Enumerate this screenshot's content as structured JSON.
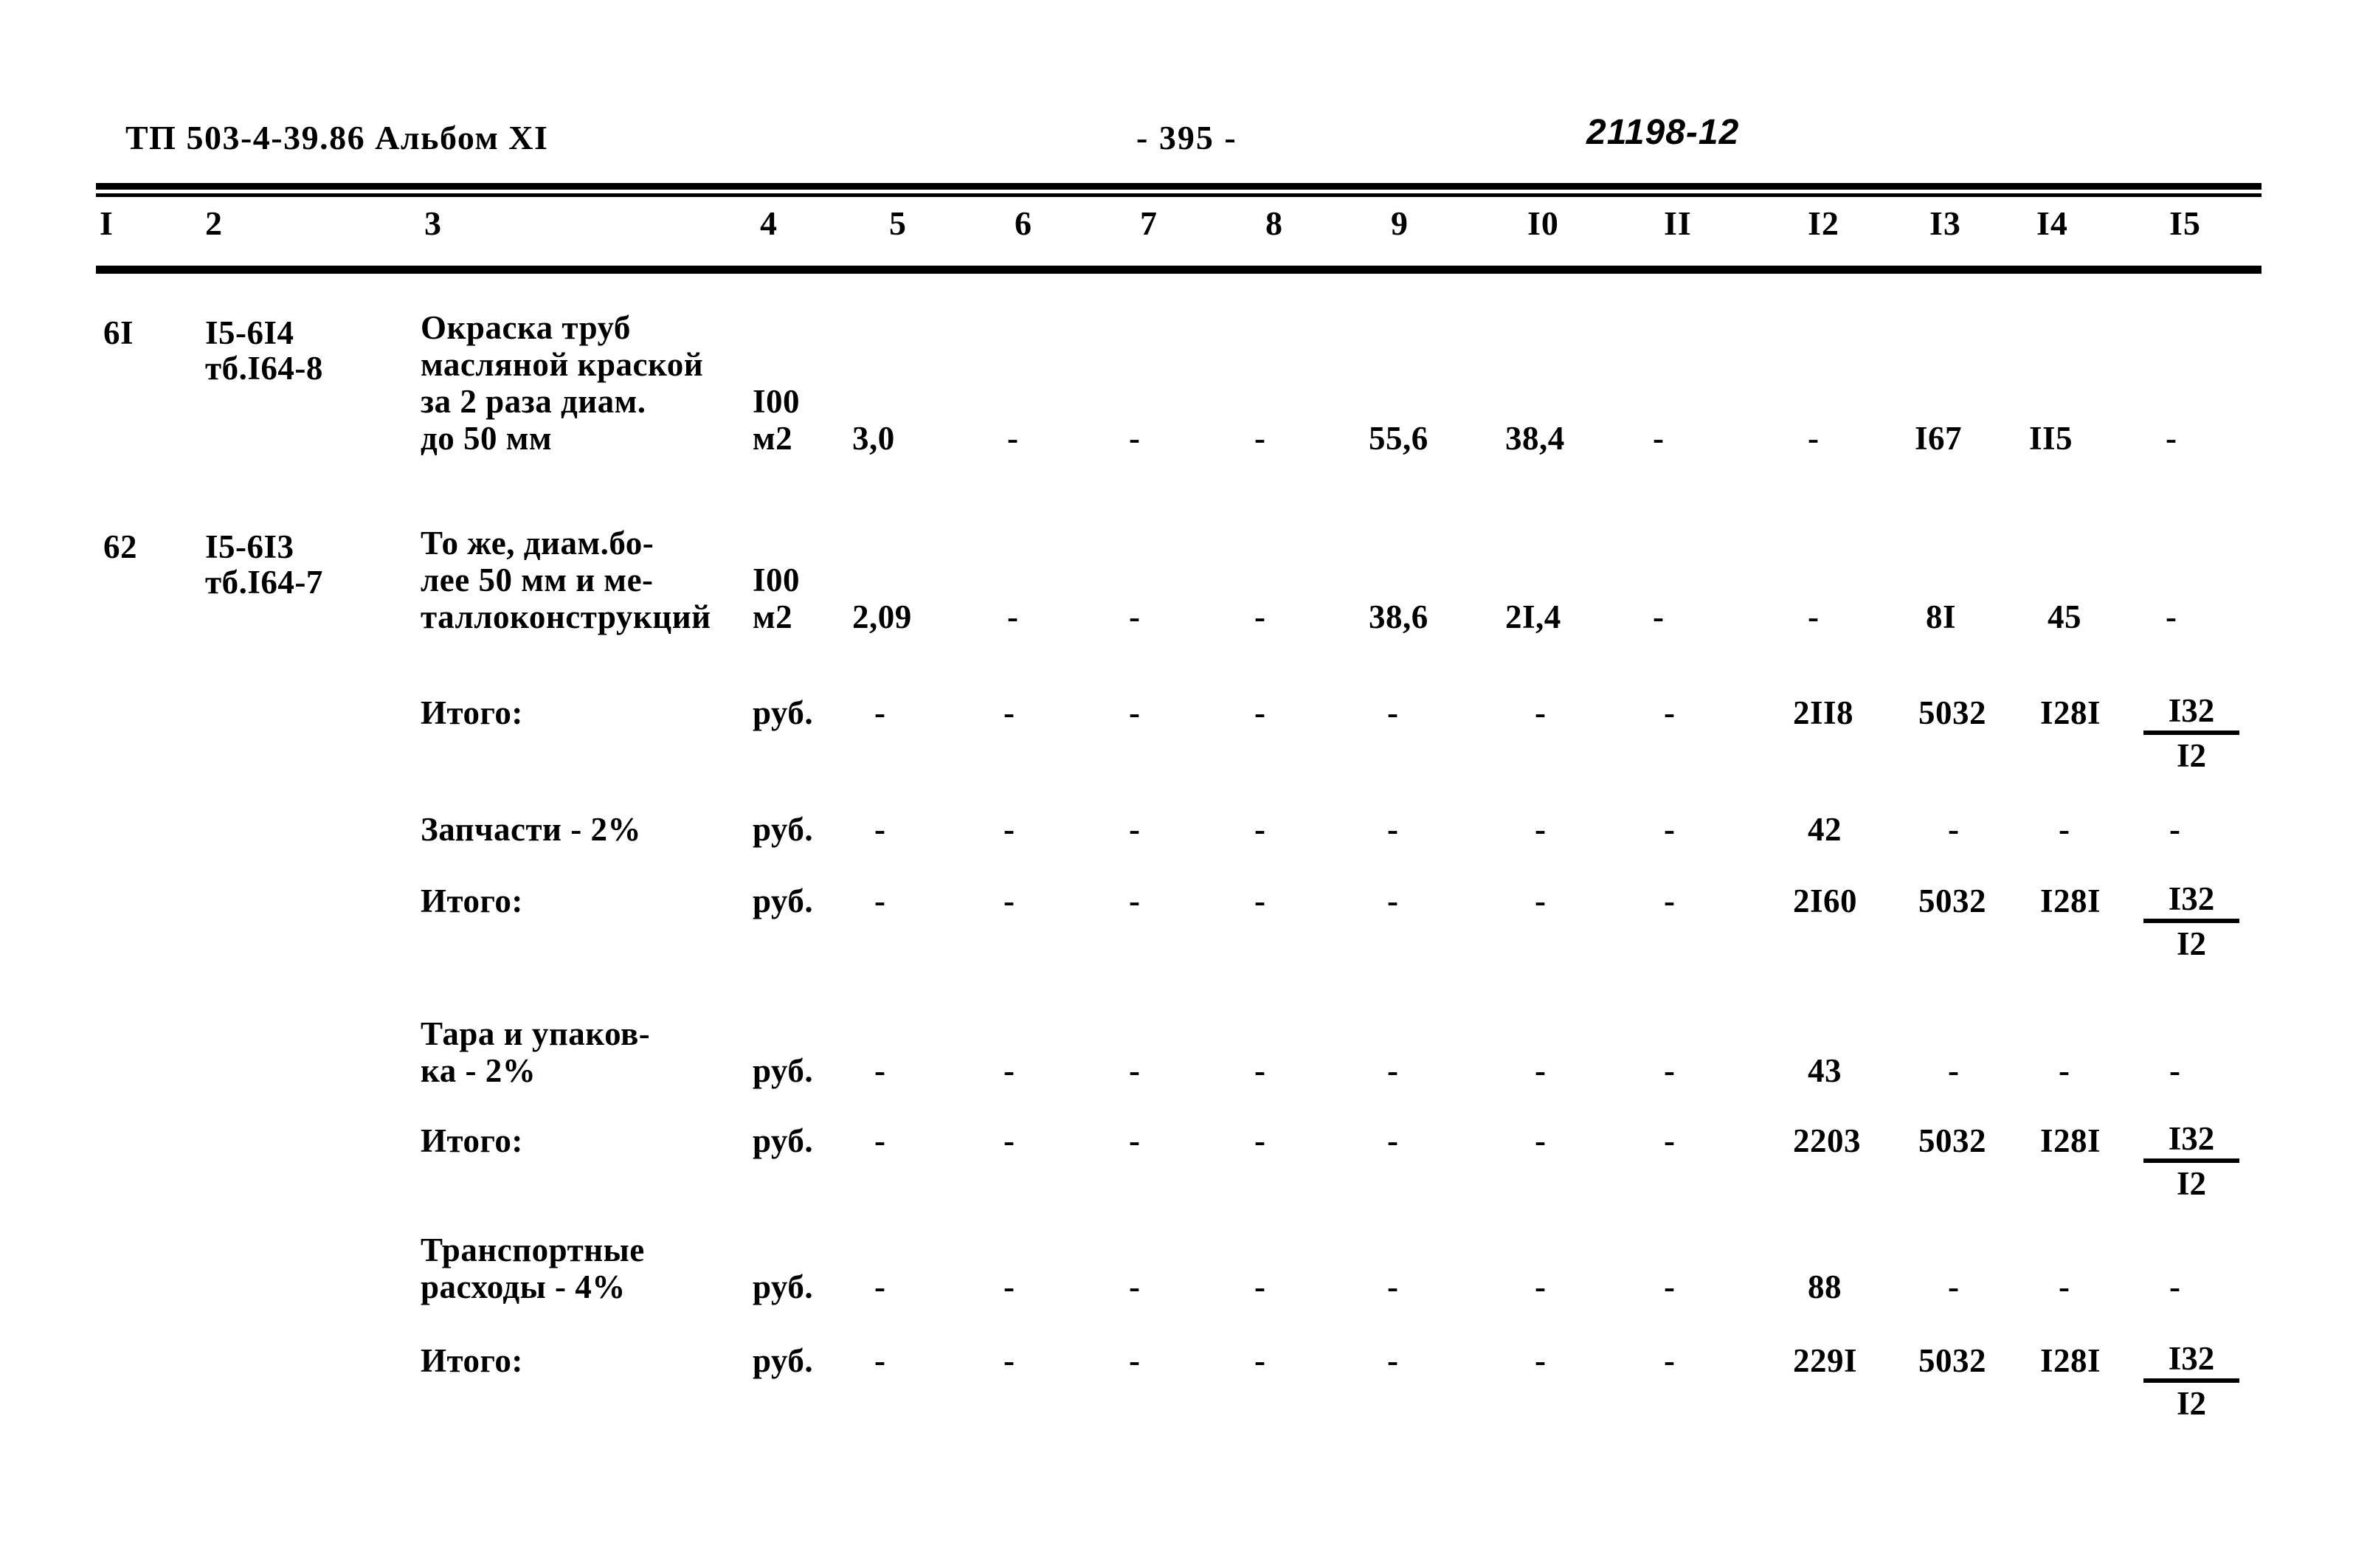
{
  "header": {
    "doc_code": "ТП 503-4-39.86 Альбом XI",
    "page_number": "- 395 -",
    "stamp": "21198-12"
  },
  "table": {
    "column_headers": [
      "I",
      "2",
      "3",
      "4",
      "5",
      "6",
      "7",
      "8",
      "9",
      "I0",
      "II",
      "I2",
      "I3",
      "I4",
      "I5"
    ],
    "rows": [
      {
        "no": "6I",
        "code_line1": "I5-6I4",
        "code_line2": "тб.I64-8",
        "desc_line1": "Окраска труб",
        "desc_line2": "масляной краской",
        "desc_line3": "за 2 раза диам.",
        "desc_line4": "до 50 мм",
        "unit_line1": "I00",
        "unit_line2": "м2",
        "c5": "3,0",
        "c6": "-",
        "c7": "-",
        "c8": "-",
        "c9": "55,6",
        "c10": "38,4",
        "c11": "-",
        "c12": "-",
        "c13": "I67",
        "c14": "II5",
        "c15": "-"
      },
      {
        "no": "62",
        "code_line1": "I5-6I3",
        "code_line2": "тб.I64-7",
        "desc_line1": "То же, диам.бо-",
        "desc_line2": "лее 50 мм и ме-",
        "desc_line3": "таллоконструкций",
        "unit_line1": "I00",
        "unit_line2": "м2",
        "c5": "2,09",
        "c6": "-",
        "c7": "-",
        "c8": "-",
        "c9": "38,6",
        "c10": "2I,4",
        "c11": "-",
        "c12": "-",
        "c13": "8I",
        "c14": "45",
        "c15": "-"
      }
    ],
    "summary_rows": [
      {
        "label_line1": "Итого:",
        "label_line2": "",
        "unit": "руб.",
        "dashes": [
          "-",
          "-",
          "-",
          "-",
          "-",
          "-",
          "-"
        ],
        "c12": "2II8",
        "c13": "5032",
        "c14": "I28I",
        "c15_num": "I32",
        "c15_den": "I2"
      },
      {
        "label_line1": "Запчасти - 2%",
        "label_line2": "",
        "unit": "руб.",
        "dashes": [
          "-",
          "-",
          "-",
          "-",
          "-",
          "-",
          "-"
        ],
        "c12": "42",
        "c13": "-",
        "c14": "-",
        "c15": "-"
      },
      {
        "label_line1": "Итого:",
        "label_line2": "",
        "unit": "руб.",
        "dashes": [
          "-",
          "-",
          "-",
          "-",
          "-",
          "-",
          "-"
        ],
        "c12": "2I60",
        "c13": "5032",
        "c14": "I28I",
        "c15_num": "I32",
        "c15_den": "I2"
      },
      {
        "label_line1": "Тара и упаков-",
        "label_line2": "ка - 2%",
        "unit": "руб.",
        "dashes": [
          "-",
          "-",
          "-",
          "-",
          "-",
          "-",
          "-"
        ],
        "c12": "43",
        "c13": "-",
        "c14": "-",
        "c15": "-"
      },
      {
        "label_line1": "Итого:",
        "label_line2": "",
        "unit": "руб.",
        "dashes": [
          "-",
          "-",
          "-",
          "-",
          "-",
          "-",
          "-"
        ],
        "c12": "2203",
        "c13": "5032",
        "c14": "I28I",
        "c15_num": "I32",
        "c15_den": "I2"
      },
      {
        "label_line1": "Транспортные",
        "label_line2": "расходы - 4%",
        "unit": "руб.",
        "dashes": [
          "-",
          "-",
          "-",
          "-",
          "-",
          "-",
          "-"
        ],
        "c12": "88",
        "c13": "-",
        "c14": "-",
        "c15": "-"
      },
      {
        "label_line1": "Итого:",
        "label_line2": "",
        "unit": "руб.",
        "dashes": [
          "-",
          "-",
          "-",
          "-",
          "-",
          "-",
          "-"
        ],
        "c12": "229I",
        "c13": "5032",
        "c14": "I28I",
        "c15_num": "I32",
        "c15_den": "I2"
      }
    ]
  }
}
